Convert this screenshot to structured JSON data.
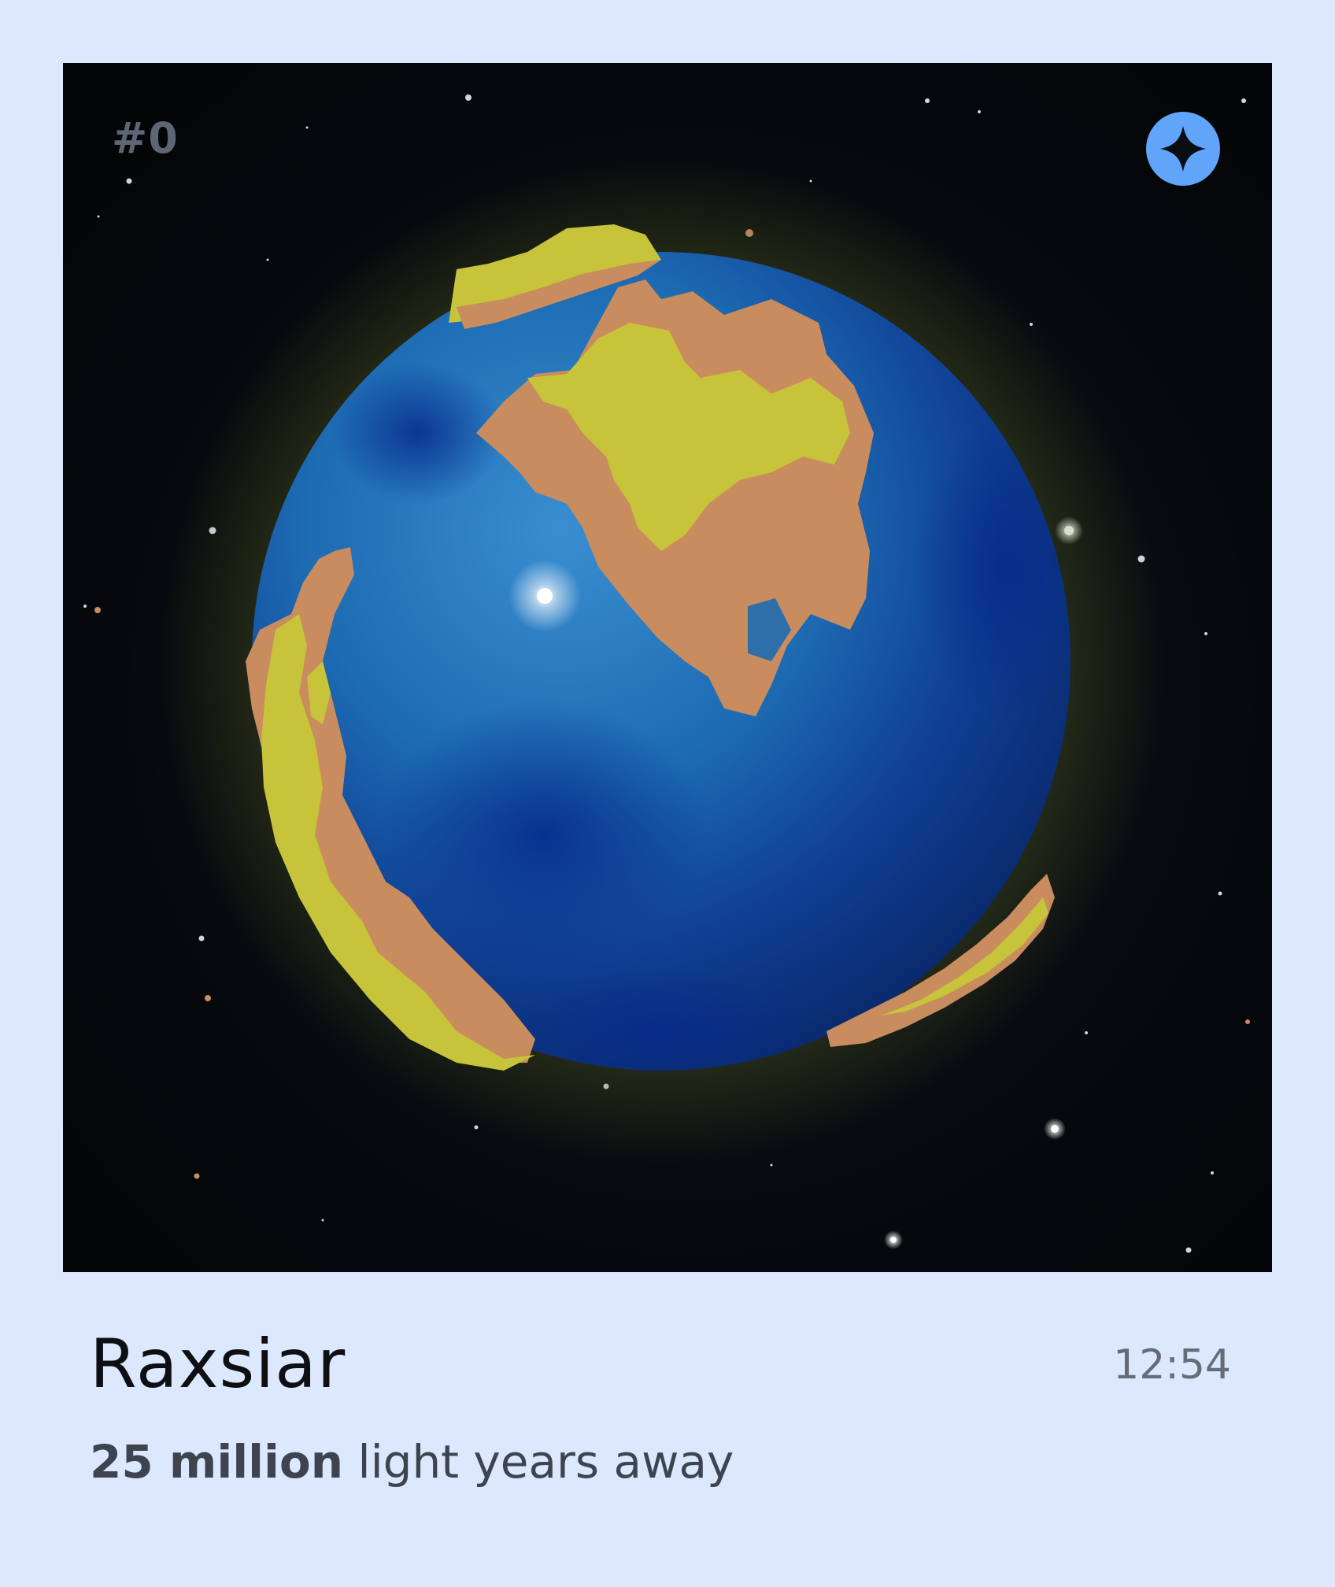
{
  "card": {
    "index_label": "#0",
    "badge_icon": "sparkle-icon",
    "accent_color": "#60a5fa",
    "background_color": "#dbe8fe"
  },
  "planet": {
    "name": "Raxsiar",
    "time": "12:54",
    "distance_value": "25 million",
    "distance_suffix": "light years away"
  }
}
